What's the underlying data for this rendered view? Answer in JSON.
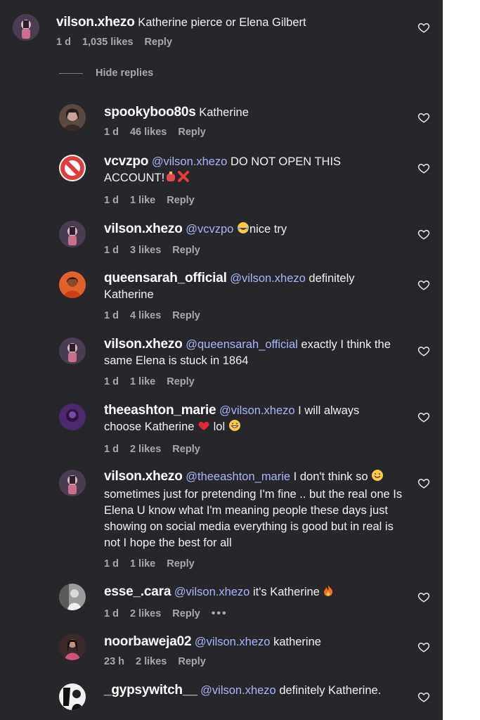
{
  "hide_replies_label": "Hide replies",
  "reply_label": "Reply",
  "top_comment": {
    "username": "vilson.xhezo",
    "text": "Katherine pierce or Elena Gilbert",
    "age": "1 d",
    "likes": "1,035 likes"
  },
  "replies": [
    {
      "username": "spookyboo80s",
      "mention": "",
      "text": "Katherine",
      "age": "1 d",
      "likes": "46 likes"
    },
    {
      "username": "vcvzpo",
      "mention": "@vilson.xhezo",
      "text": "DO NOT OPEN THIS ACCOUNT!",
      "age": "1 d",
      "likes": "1 like"
    },
    {
      "username": "vilson.xhezo",
      "mention": "@vcvzpo",
      "text": "nice try",
      "age": "1 d",
      "likes": "3 likes"
    },
    {
      "username": "queensarah_official",
      "mention": "@vilson.xhezo",
      "text": "definitely Katherine",
      "age": "1 d",
      "likes": "4 likes"
    },
    {
      "username": "vilson.xhezo",
      "mention": "@queensarah_official",
      "text": "exactly I think the same Elena is stuck in 1864",
      "age": "1 d",
      "likes": "1 like"
    },
    {
      "username": "theeashton_marie",
      "mention": "@vilson.xhezo",
      "text": "I will always choose Katherine",
      "text2": "lol",
      "age": "1 d",
      "likes": "2 likes"
    },
    {
      "username": "vilson.xhezo",
      "mention": "@theeashton_marie",
      "text": "I don't think so",
      "text2": "sometimes just for pretending I'm fine .. but the real one Is Elena U know what I'm meaning people these days just showing on social media everything is good but in real is not I hope the best for all",
      "age": "1 d",
      "likes": "1 like"
    },
    {
      "username": "esse_.cara",
      "mention": "@vilson.xhezo",
      "text": "it's Katherine",
      "age": "1 d",
      "likes": "2 likes",
      "more": "•••"
    },
    {
      "username": "noorbaweja02",
      "mention": "@vilson.xhezo",
      "text": "katherine",
      "age": "23 h",
      "likes": "2 likes"
    },
    {
      "username": "_gypsywitch__",
      "mention": "@vilson.xhezo",
      "text": "definitely Katherine.",
      "age": "",
      "likes": ""
    }
  ],
  "colors": {
    "background": "#26262b",
    "mention": "#a9b6f7",
    "meta": "#a8a8ad"
  }
}
